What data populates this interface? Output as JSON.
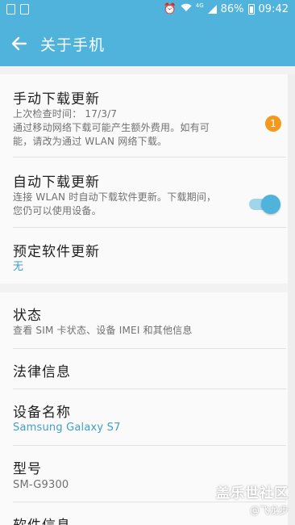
{
  "status_bar": {
    "network": "4G",
    "battery": "86%",
    "time": "09:42",
    "icons": [
      "image-icon",
      "sim-icon",
      "alarm-icon",
      "wifi-icon",
      "signal-icon",
      "battery-icon"
    ]
  },
  "app_bar": {
    "title": "关于手机",
    "back_icon": "arrow-left-icon"
  },
  "colors": {
    "accent": "#4fb3dc",
    "badge": "#f39a1e",
    "link_text": "#3f9fc8"
  },
  "section1": {
    "manual_update": {
      "title": "手动下载更新",
      "last_check": "上次检查时间： 17/3/7",
      "desc1": "通过移动网络下载可能产生额外费用。如有可",
      "desc2": "能，请改为通过 WLAN 网络下载。",
      "badge": "1"
    },
    "auto_update": {
      "title": "自动下载更新",
      "desc1": "连接 WLAN 时自动下载软件更新。下载期间，",
      "desc2": "您仍可以使用设备。",
      "enabled": true
    },
    "scheduled_update": {
      "title": "预定软件更新",
      "value": "无"
    }
  },
  "section2": {
    "status": {
      "title": "状态",
      "desc": "查看 SIM 卡状态、设备 IMEI 和其他信息"
    },
    "legal": {
      "title": "法律信息"
    },
    "device_name": {
      "title": "设备名称",
      "value": "Samsung Galaxy S7"
    },
    "model": {
      "title": "型号",
      "value": "SM-G9300"
    },
    "software_info": {
      "title": "软件信息"
    }
  },
  "watermark": {
    "main": "盖乐世社区",
    "sub": "@飞龙步"
  }
}
